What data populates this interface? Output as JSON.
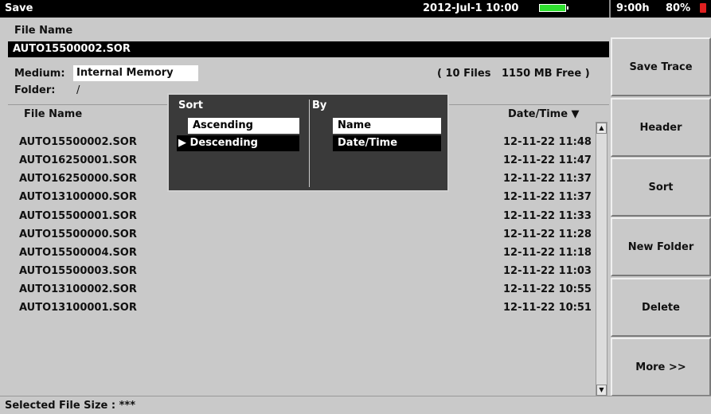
{
  "topbar": {
    "title": "Save",
    "datetime": "2012-Jul-1 10:00",
    "time_left": "9:00h",
    "battery_pct": "80%"
  },
  "file": {
    "name_label": "File Name",
    "name_value": "AUTO15500002.SOR"
  },
  "medium": {
    "label": "Medium:",
    "value": "Internal Memory",
    "info": "( 10 Files   1150 MB Free )"
  },
  "folder": {
    "label": "Folder:",
    "value": "/"
  },
  "list": {
    "col_name": "File Name",
    "col_datetime": "Date/Time ▼",
    "rows": [
      {
        "name": "AUTO15500002.SOR",
        "datetime": "12-11-22 11:48"
      },
      {
        "name": "AUTO16250001.SOR",
        "datetime": "12-11-22 11:47"
      },
      {
        "name": "AUTO16250000.SOR",
        "datetime": "12-11-22 11:37"
      },
      {
        "name": "AUTO13100000.SOR",
        "datetime": "12-11-22 11:37"
      },
      {
        "name": "AUTO15500001.SOR",
        "datetime": "12-11-22 11:33"
      },
      {
        "name": "AUTO15500000.SOR",
        "datetime": "12-11-22 11:28"
      },
      {
        "name": "AUTO15500004.SOR",
        "datetime": "12-11-22 11:18"
      },
      {
        "name": "AUTO15500003.SOR",
        "datetime": "12-11-22 11:03"
      },
      {
        "name": "AUTO13100002.SOR",
        "datetime": "12-11-22 10:55"
      },
      {
        "name": "AUTO13100001.SOR",
        "datetime": "12-11-22 10:51"
      }
    ]
  },
  "sort_popup": {
    "sort_label": "Sort",
    "by_label": "By",
    "ascending": "Ascending",
    "descending": "▶ Descending",
    "name": "Name",
    "datetime": "Date/Time"
  },
  "sidebar": {
    "save_trace": "Save Trace",
    "header": "Header",
    "sort": "Sort",
    "new_folder": "New Folder",
    "delete": "Delete",
    "more": "More >>"
  },
  "footer": {
    "status": "Selected File Size : ***"
  },
  "colors": {
    "accent_battery": "#2fe02f",
    "battery_low_icon": "#e02020",
    "popup_bg": "#3a3a3a"
  }
}
